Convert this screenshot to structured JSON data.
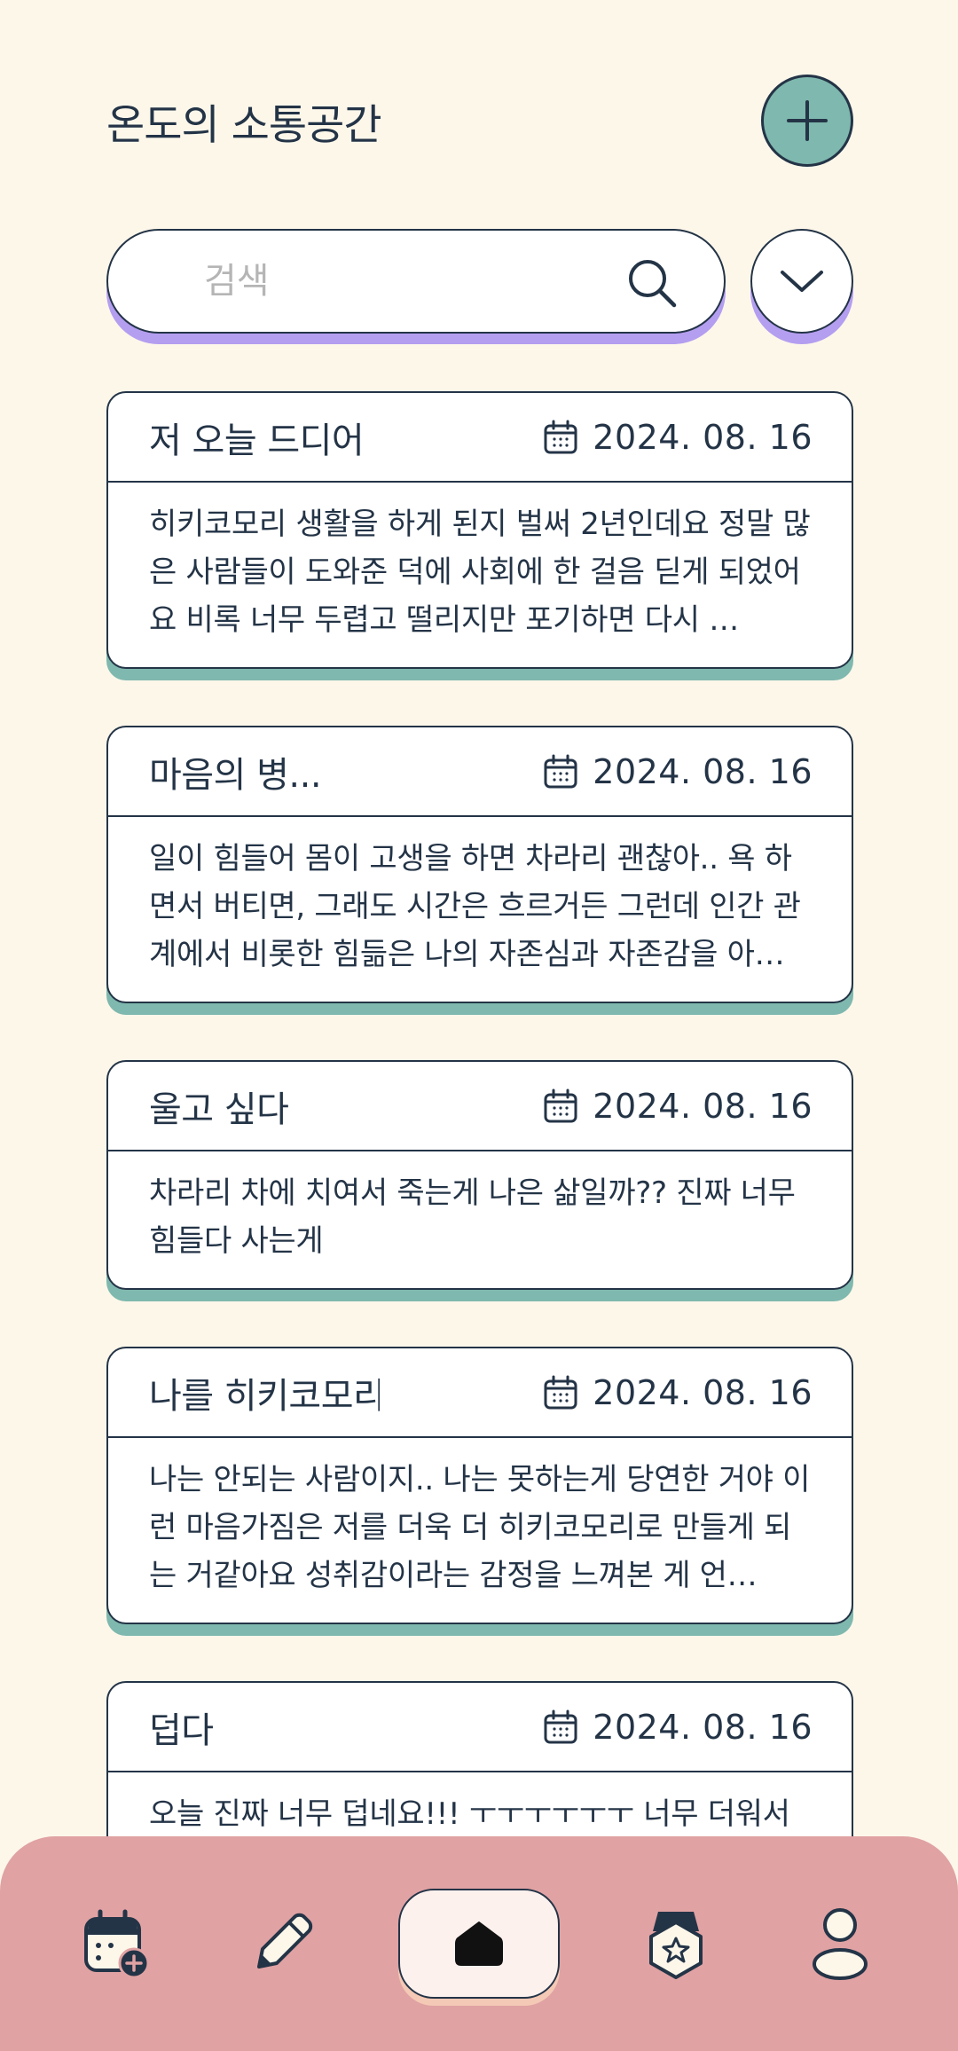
{
  "header": {
    "title": "온도의 소통공간",
    "add_icon": "plus-icon"
  },
  "search": {
    "placeholder": "검색",
    "value": "",
    "icon": "search-icon",
    "filter_icon": "chevron-down-icon"
  },
  "posts": [
    {
      "title": "저 오늘 드디어",
      "date": "2024. 08. 16",
      "body": "히키코모리 생활을 하게 된지 벌써 2년인데요 정말 많은 사람들이 도와준 덕에 사회에 한 걸음 딛게 되었어요 비록 너무 두렵고 떨리지만 포기하면 다시 …"
    },
    {
      "title": "마음의 병...",
      "date": "2024. 08. 16",
      "body": "일이 힘들어 몸이 고생을 하면 차라리 괜찮아.. 욕 하면서 버티면, 그래도 시간은 흐르거든 그런데 인간 관계에서 비롯한 힘듦은 나의 자존심과 자존감을 아…"
    },
    {
      "title": "울고 싶다",
      "date": "2024. 08. 16",
      "body": "차라리 차에 치여서 죽는게 나은 삶일까?? 진짜 너무 힘들다 사는게"
    },
    {
      "title": "나를 히키코모리",
      "date": "2024. 08. 16",
      "body": "나는 안되는 사람이지.. 나는 못하는게 당연한 거야 이런 마음가짐은 저를 더욱 더 히키코모리로 만들게 되는 거같아요 성취감이라는 감정을 느껴본 게 언…"
    },
    {
      "title": "덥다",
      "date": "2024. 08. 16",
      "body": "오늘 진짜 너무 덥네요!!! ㅜㅜㅜㅜㅜㅜ 너무 더워서 아무것도 못하겠어요"
    }
  ],
  "nav": {
    "items": [
      {
        "icon": "calendar-add-icon"
      },
      {
        "icon": "pencil-icon"
      },
      {
        "icon": "home-icon",
        "active": true
      },
      {
        "icon": "badge-star-icon"
      },
      {
        "icon": "profile-icon"
      }
    ]
  },
  "colors": {
    "background": "#fdf7ea",
    "accent_teal": "#7fb8ae",
    "accent_purple": "#b49ef0",
    "nav_bg": "#e0a2a3",
    "text": "#243447"
  }
}
